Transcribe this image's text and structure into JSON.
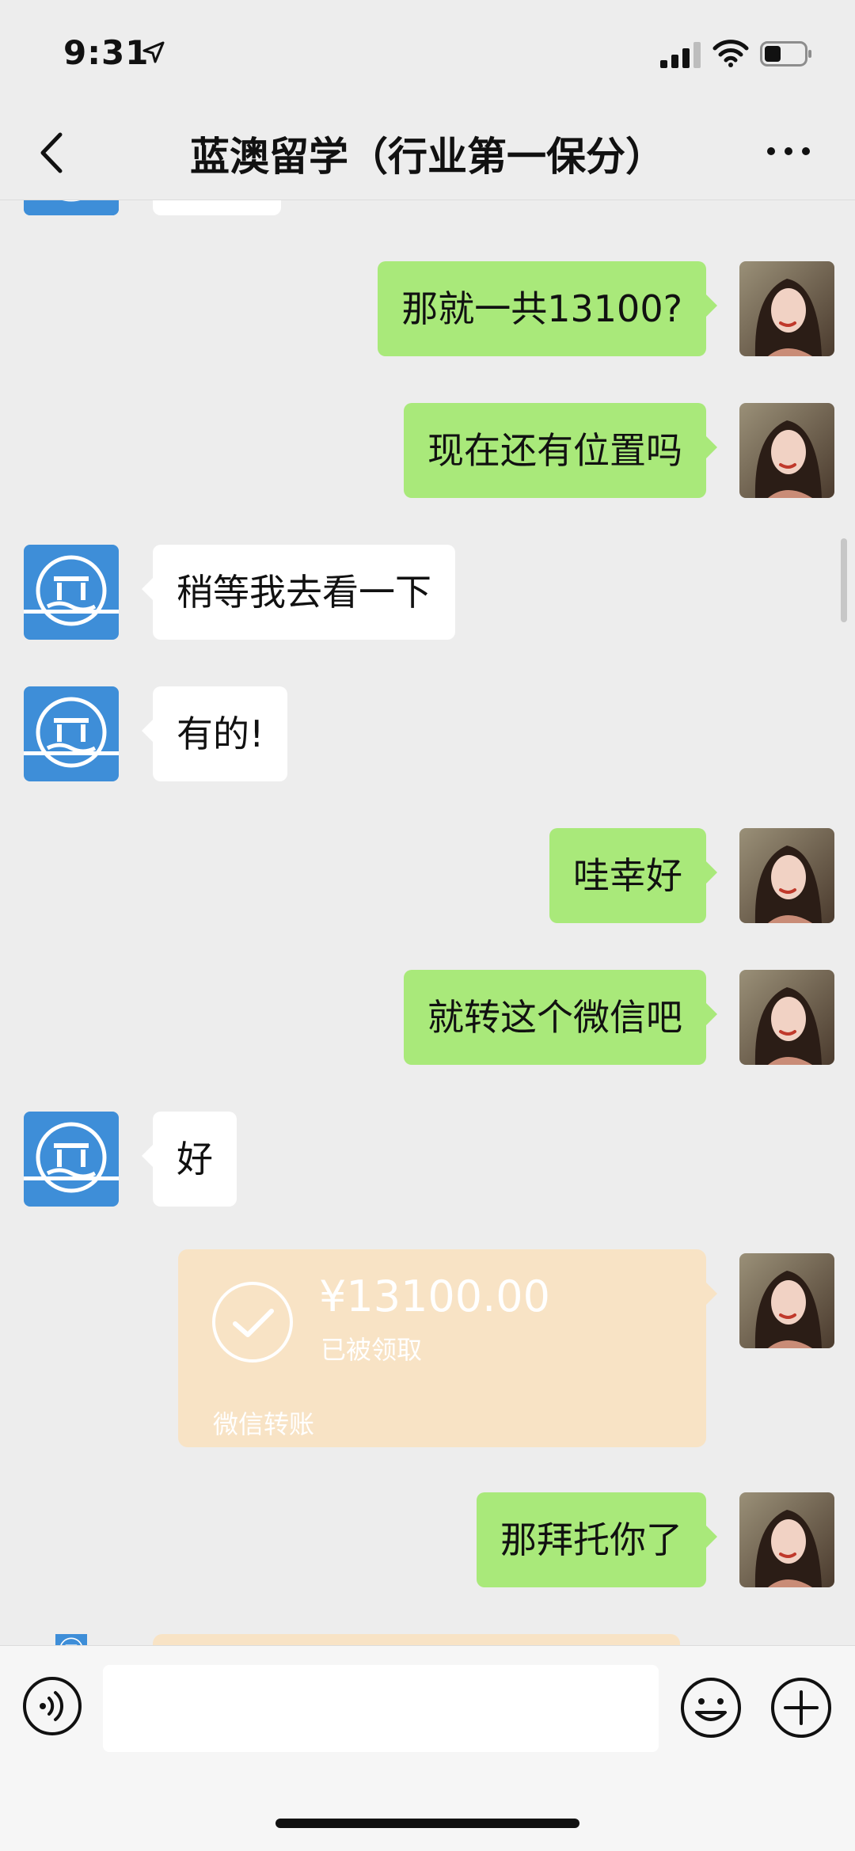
{
  "status_bar": {
    "time": "9:31"
  },
  "header": {
    "title": "蓝澳留学（行业第一保分）"
  },
  "messages": [
    {
      "id": "m1",
      "side": "out",
      "text": "那就一共13100?"
    },
    {
      "id": "m2",
      "side": "out",
      "text": "现在还有位置吗"
    },
    {
      "id": "m3",
      "side": "in",
      "text": "稍等我去看一下"
    },
    {
      "id": "m4",
      "side": "in",
      "text": "有的!"
    },
    {
      "id": "m5",
      "side": "out",
      "text": "哇幸好"
    },
    {
      "id": "m6",
      "side": "out",
      "text": "就转这个微信吧"
    },
    {
      "id": "m7",
      "side": "in",
      "text": "好"
    },
    {
      "id": "m9",
      "side": "out",
      "text": "那拜托你了"
    }
  ],
  "transfer": {
    "amount": "¥13100.00",
    "status": "已被领取",
    "label": "微信转账"
  },
  "input": {
    "value": "",
    "placeholder": ""
  },
  "colors": {
    "background": "#ededed",
    "bubble_out": "#a9e97a",
    "bubble_in": "#ffffff",
    "transfer_card": "#f8e3c5",
    "agency_avatar": "#3e8ed8"
  },
  "icons": {
    "back": "back-chevron-icon",
    "more": "more-dots-icon",
    "voice": "voice-icon",
    "emoji": "emoji-icon",
    "plus": "plus-icon",
    "check": "check-circle-icon"
  }
}
